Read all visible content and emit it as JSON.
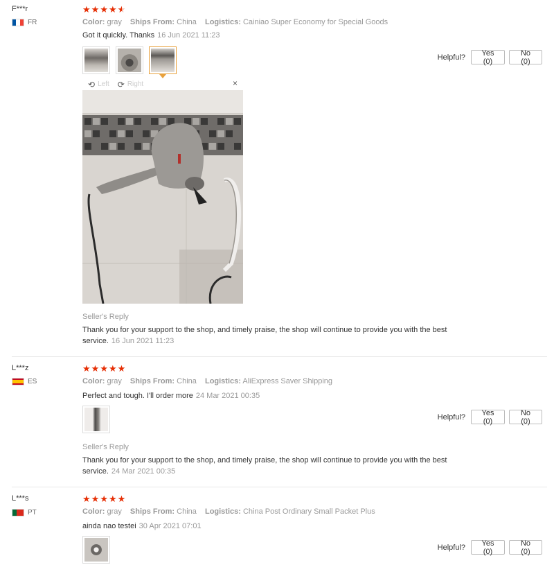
{
  "labels": {
    "color": "Color:",
    "ships_from": "Ships From:",
    "logistics": "Logistics:",
    "helpful": "Helpful?",
    "seller_reply": "Seller's Reply",
    "rotate_left": "Left",
    "rotate_right": "Right",
    "close": "×"
  },
  "colors": {
    "stars": "#e62e04",
    "active_thumb": "#e8a13c"
  },
  "reviews": [
    {
      "user": "F***r",
      "country": "FR",
      "rating": 4.5,
      "color_value": "gray",
      "ships_from_value": "China",
      "logistics_value": "Cainiao Super Economy for Special Goods",
      "comment": "Got it quickly. Thanks",
      "date": "16 Jun 2021 11:23",
      "yes": "Yes (0)",
      "no": "No (0)",
      "reply_text_1": "Thank you for your support to the shop, and timely praise, the shop will continue to provide you with the best",
      "reply_text_2": "service.",
      "reply_date": "16 Jun 2021 11:23"
    },
    {
      "user": "L***z",
      "country": "ES",
      "rating": 5,
      "color_value": "gray",
      "ships_from_value": "China",
      "logistics_value": "AliExpress Saver Shipping",
      "comment": "Perfect and tough. I'll order more",
      "date": "24 Mar 2021 00:35",
      "yes": "Yes (0)",
      "no": "No (0)",
      "reply_text_1": "Thank you for your support to the shop, and timely praise, the shop will continue to provide you with the best",
      "reply_text_2": "service.",
      "reply_date": "24 Mar 2021 00:35"
    },
    {
      "user": "L***s",
      "country": "PT",
      "rating": 5,
      "color_value": "gray",
      "ships_from_value": "China",
      "logistics_value": "China Post Ordinary Small Packet Plus",
      "comment": "ainda nao testei",
      "date": "30 Apr 2021 07:01",
      "yes": "Yes (0)",
      "no": "No (0)"
    }
  ]
}
